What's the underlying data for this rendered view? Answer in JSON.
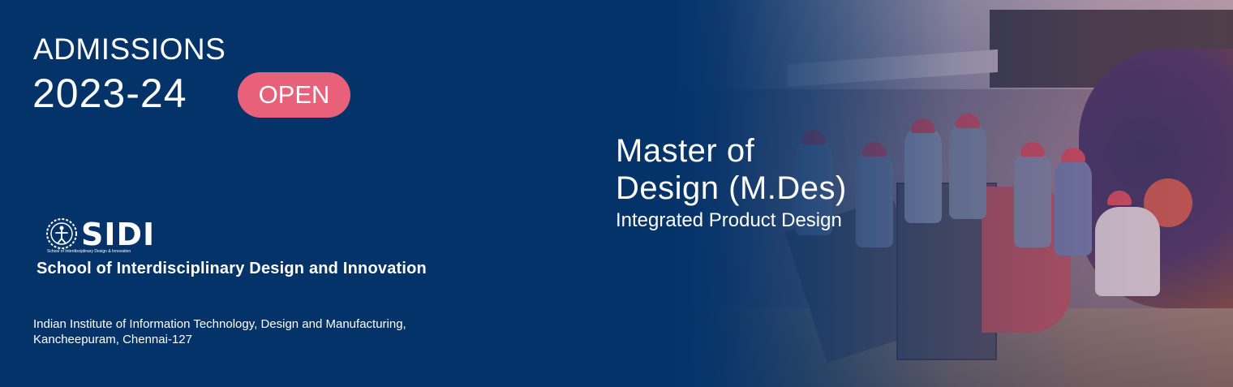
{
  "admissions": {
    "label": "ADMISSIONS",
    "year": "2023-24",
    "status_badge": "OPEN"
  },
  "logo": {
    "name": "SIDI",
    "tagline": "School of Interdisciplinary Design & Innovation"
  },
  "school_name": "School of Interdisciplinary Design and Innovation",
  "institute": {
    "line1": "Indian Institute of Information Technology, Design and Manufacturing,",
    "line2": "Kancheepuram, Chennai-127"
  },
  "program": {
    "title_line1": "Master of",
    "title_line2": "Design (M.Des)",
    "specialization": "Integrated Product Design"
  },
  "colors": {
    "background": "#04336a",
    "badge": "#e9607a",
    "text": "#ffffff"
  },
  "icons": {
    "emblem": "sidi-emblem-icon"
  }
}
